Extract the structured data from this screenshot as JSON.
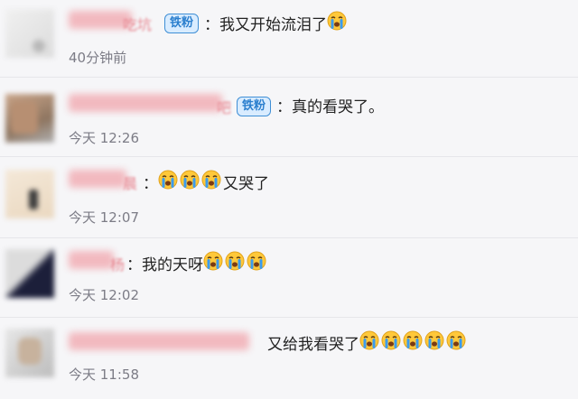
{
  "comments": [
    {
      "name_suffix": "吃坑",
      "badge": "铁粉",
      "separator": "：",
      "text": "我又开始流泪了",
      "emoji_icon": "crying-face-icon",
      "emoji_count": 1,
      "time": "40分钟前"
    },
    {
      "name_suffix": "吧",
      "badge": "铁粉",
      "separator": "：",
      "text": "真的看哭了。",
      "emoji_icon": "",
      "emoji_count": 0,
      "time": "今天 12:26"
    },
    {
      "name_suffix": "晨",
      "badge": "",
      "separator": "：",
      "text_before": "",
      "text": "又哭了",
      "emoji_icon": "crying-face-icon",
      "emoji_count": 3,
      "time": "今天 12:07"
    },
    {
      "name_suffix": "杨",
      "badge": "",
      "separator": "：",
      "text": "我的天呀",
      "emoji_icon": "crying-face-icon",
      "emoji_count": 3,
      "time": "今天 12:02"
    },
    {
      "name_suffix": "",
      "badge": "",
      "separator": "",
      "text": "又给我看哭了",
      "emoji_icon": "crying-face-icon",
      "emoji_count": 5,
      "time": "今天 11:58"
    }
  ],
  "colors": {
    "background": "#f6f6f8",
    "name_pink": "#e78791",
    "badge_blue": "#2b7fce",
    "badge_fill": "#d9ecff",
    "time_gray": "#7c7c86",
    "emoji_yellow": "#ffc83a",
    "tear_blue": "#3a9bef"
  }
}
